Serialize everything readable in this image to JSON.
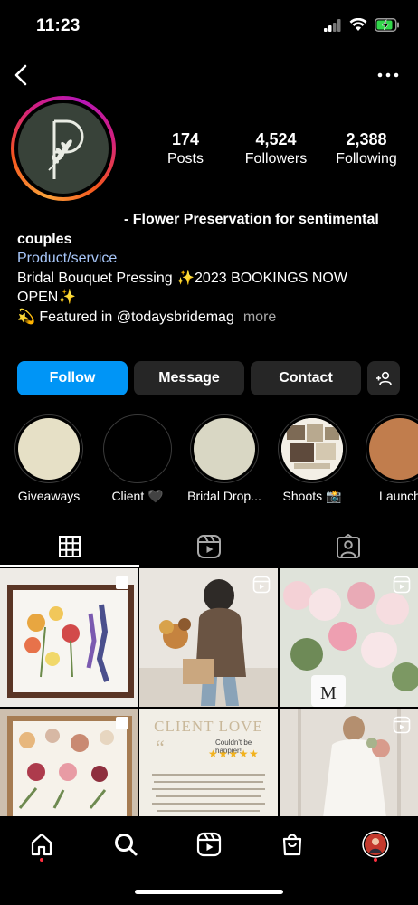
{
  "status_bar": {
    "time": "11:23"
  },
  "profile": {
    "stats": [
      {
        "value": "174",
        "label": "Posts"
      },
      {
        "value": "4,524",
        "label": "Followers"
      },
      {
        "value": "2,388",
        "label": "Following"
      }
    ],
    "bio": {
      "name_line_1": "- Flower Preservation for sentimental",
      "name_line_2": "couples",
      "category": "Product/service",
      "line_1": "Bridal Bouquet Pressing ✨2023 BOOKINGS NOW",
      "line_2": "OPEN✨",
      "line_3": "💫 Featured in @todaysbridemag",
      "more": "more"
    }
  },
  "actions": {
    "follow": "Follow",
    "message": "Message",
    "contact": "Contact"
  },
  "highlights": [
    {
      "label": "Giveaways",
      "color": "#e6e0c6"
    },
    {
      "label": "Client 🖤",
      "color": "#000000"
    },
    {
      "label": "Bridal Drop...",
      "color": "#d9d7c4"
    },
    {
      "label": "Shoots 📸",
      "color": "#ffffff"
    },
    {
      "label": "Launch",
      "color": "#c17d4d"
    }
  ],
  "grid": {
    "client_love_title": "CLIENT LOVE",
    "client_love_sub": "Couldn't be happier!",
    "client_love_stars": "★★★★★"
  },
  "colors": {
    "follow_button": "#0095f6",
    "button_dark": "#262626",
    "avatar_bg": "#384239",
    "notification_dot": "#ff3040"
  }
}
